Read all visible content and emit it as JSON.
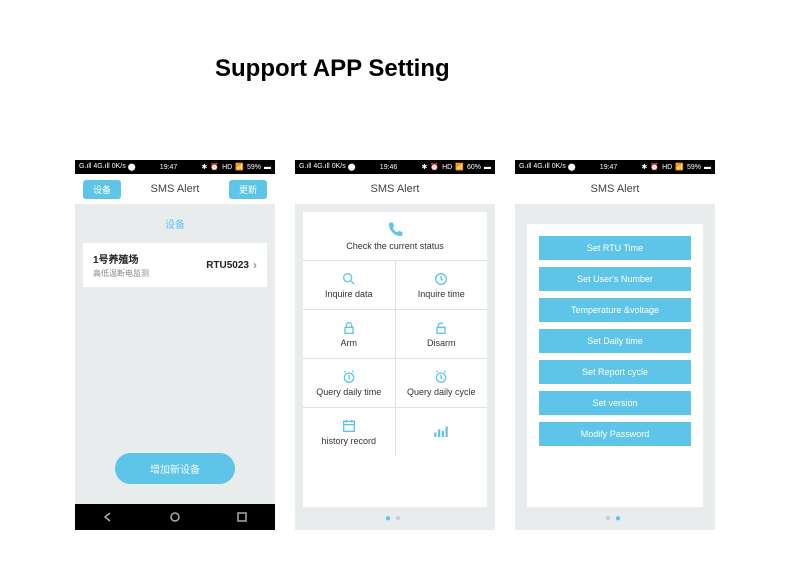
{
  "page_title": "Support APP Setting",
  "statusbar": {
    "signal": "G.ıll 4G.ıll",
    "speed": "0K/s",
    "time": "19:47",
    "time2": "19:46",
    "bt": "✱",
    "hd": "HD",
    "battery": "59%",
    "battery2": "60%"
  },
  "screen1": {
    "appbar_left": "设备",
    "appbar_title": "SMS Alert",
    "appbar_right": "更新",
    "devices_header": "设备",
    "device_name": "1号养殖场",
    "device_sub": "高低温断电监测",
    "device_model": "RTU5023",
    "add_button": "增加新设备"
  },
  "screen2": {
    "appbar_title": "SMS Alert",
    "cells": {
      "check_status": "Check the current status",
      "inquire_data": "Inquire data",
      "inquire_time": "Inquire time",
      "arm": "Arm",
      "disarm": "Disarm",
      "query_daily_time": "Query daily time",
      "query_daily_cycle": "Query daily cycle",
      "history_record": "history record"
    }
  },
  "screen3": {
    "appbar_title": "SMS Alert",
    "buttons": [
      "Set RTU Time",
      "Set User's Number",
      "Temperature &voltage",
      "Set Daily time",
      "Set Report cycle",
      "Set version",
      "Modify Password"
    ]
  }
}
